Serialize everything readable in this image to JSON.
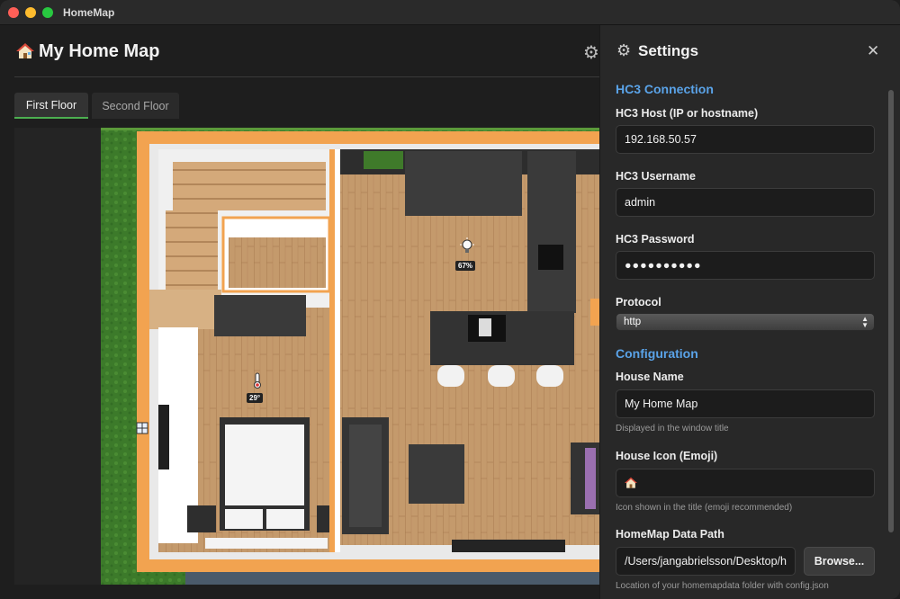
{
  "app": {
    "window_title": "HomeMap"
  },
  "header": {
    "title": "My Home Map",
    "house_icon": "house-icon",
    "settings_icon": "gear-icon"
  },
  "tabs": [
    {
      "label": "First Floor",
      "active": true
    },
    {
      "label": "Second Floor",
      "active": false
    }
  ],
  "map": {
    "devices": [
      {
        "type": "light",
        "icon": "lightbulb-icon",
        "value": "67%"
      },
      {
        "type": "temperature",
        "icon": "thermometer-icon",
        "value": "29°"
      },
      {
        "type": "window",
        "icon": "window-icon"
      }
    ]
  },
  "settings": {
    "title": "Settings",
    "close_label": "✕",
    "hc3_section": "HC3 Connection",
    "host_label": "HC3 Host (IP or hostname)",
    "host_value": "192.168.50.57",
    "username_label": "HC3 Username",
    "username_value": "admin",
    "password_label": "HC3 Password",
    "password_value": "●●●●●●●●●●",
    "protocol_label": "Protocol",
    "protocol_value": "http",
    "config_section": "Configuration",
    "house_name_label": "House Name",
    "house_name_value": "My Home Map",
    "house_name_help": "Displayed in the window title",
    "house_icon_label": "House Icon (Emoji)",
    "house_icon_help": "Icon shown in the title (emoji recommended)",
    "data_path_label": "HomeMap Data Path",
    "data_path_value": "/Users/jangabrielsson/Desktop/homemapdata",
    "browse_label": "Browse...",
    "data_path_help": "Location of your homemapdata folder with config.json"
  },
  "colors": {
    "accent": "#4caf50",
    "section": "#5aa3e8",
    "outer_wall": "#f2a350",
    "floor": "#c49a6c"
  }
}
